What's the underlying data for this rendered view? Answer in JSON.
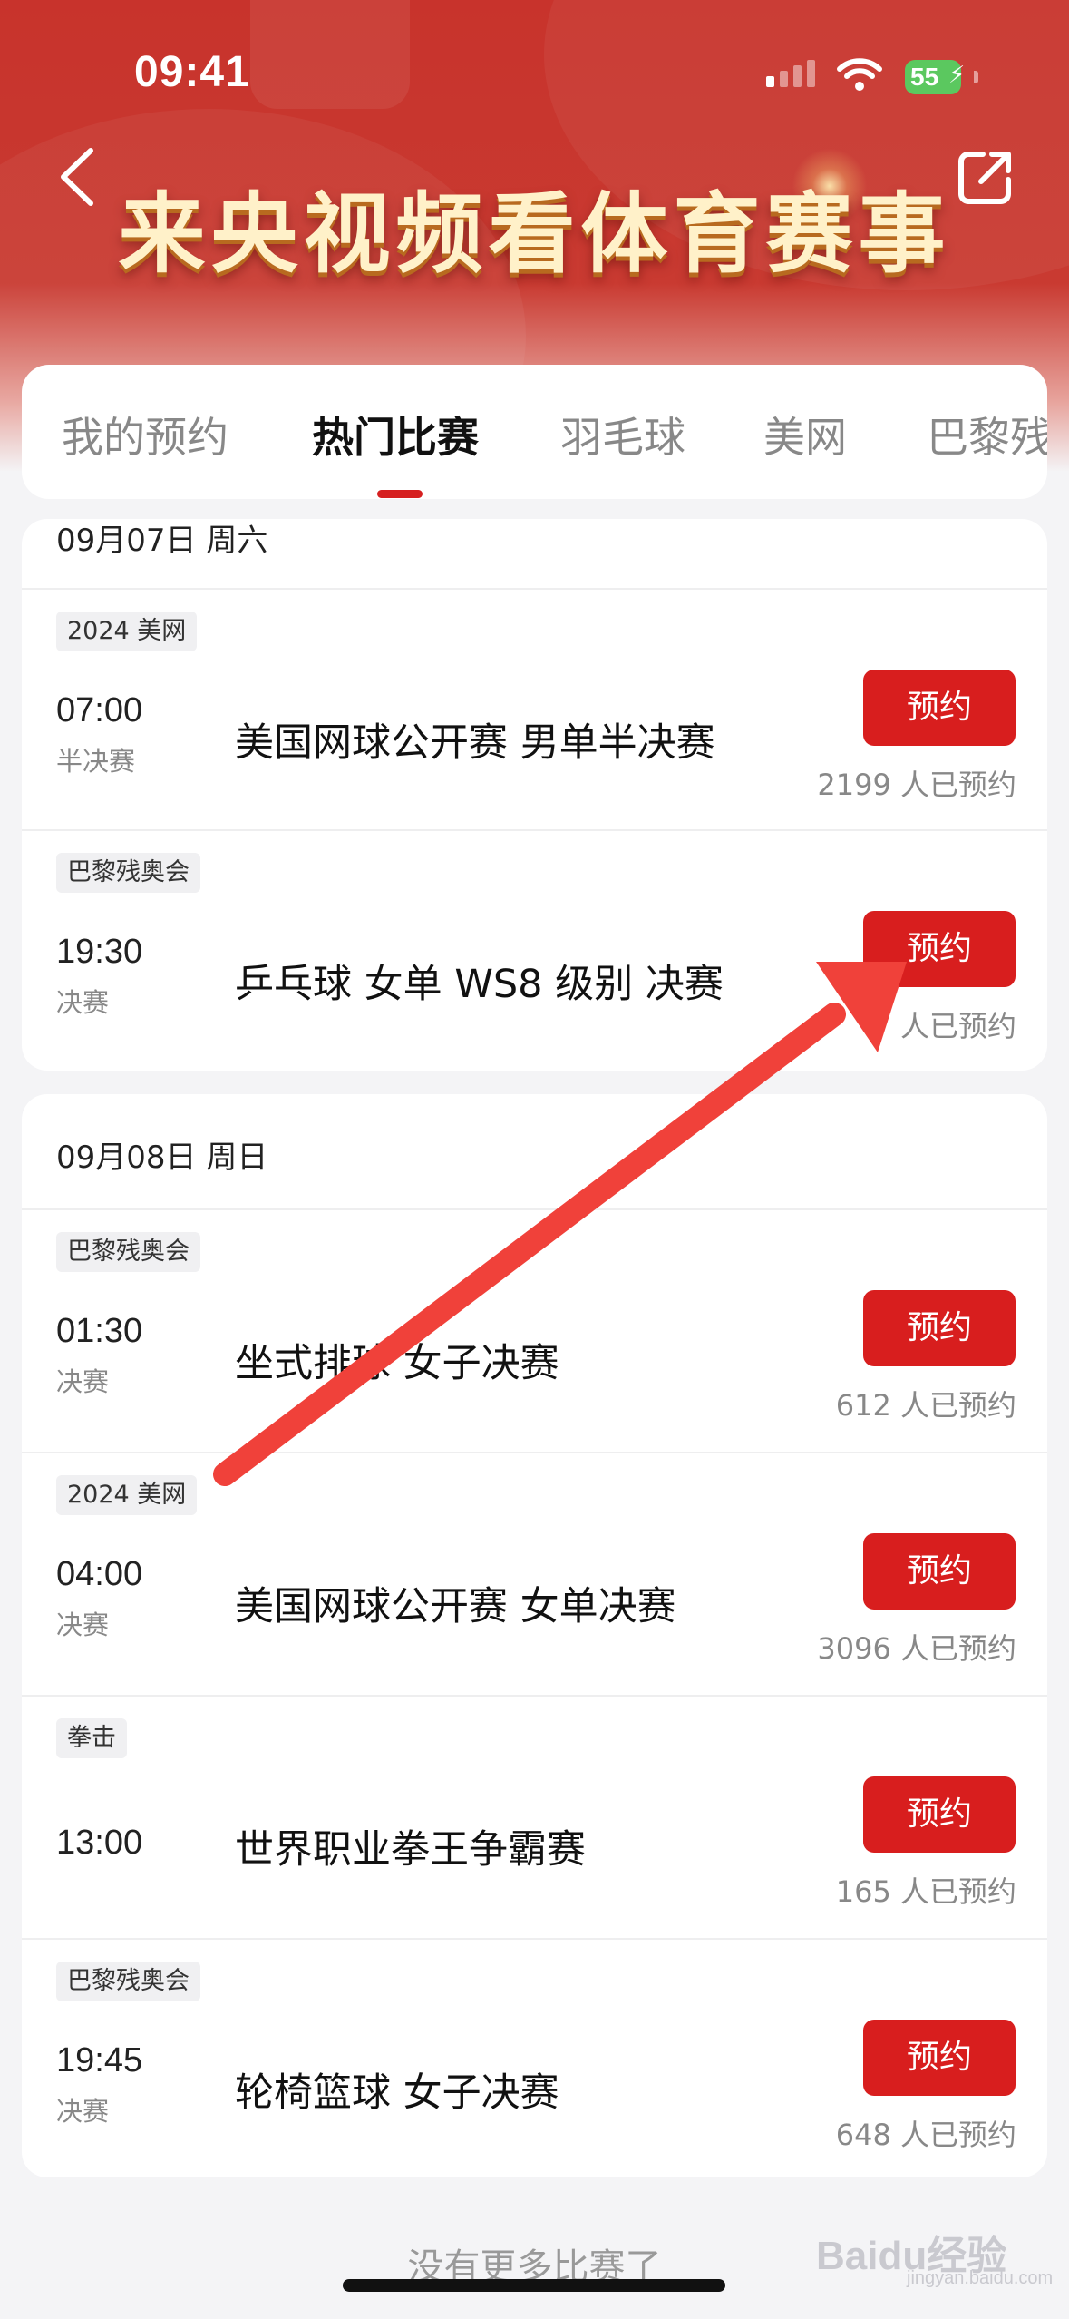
{
  "status_bar": {
    "time": "09:41",
    "battery": "55"
  },
  "header": {
    "title": "来央视频看体育赛事",
    "back_icon": "chevron-left-icon",
    "share_icon": "share-icon"
  },
  "tabs": [
    {
      "label": "我的预约"
    },
    {
      "label": "热门比赛"
    },
    {
      "label": "羽毛球"
    },
    {
      "label": "美网"
    },
    {
      "label": "巴黎残"
    }
  ],
  "active_tab": "热门比赛",
  "days": [
    {
      "date": "09月07日 周六",
      "events": [
        {
          "tag": "2024 美网",
          "time": "07:00",
          "stage": "半决赛",
          "title": "美国网球公开赛 男单半决赛",
          "button": "预约",
          "booked": "2199 人已预约"
        },
        {
          "tag": "巴黎残奥会",
          "time": "19:30",
          "stage": "决赛",
          "title": "乒乓球 女单 WS8 级别 决赛",
          "button": "预约",
          "booked": "7 人已预约"
        }
      ]
    },
    {
      "date": "09月08日 周日",
      "events": [
        {
          "tag": "巴黎残奥会",
          "time": "01:30",
          "stage": "决赛",
          "title": "坐式排球 女子决赛",
          "button": "预约",
          "booked": "612 人已预约"
        },
        {
          "tag": "2024 美网",
          "time": "04:00",
          "stage": "决赛",
          "title": "美国网球公开赛 女单决赛",
          "button": "预约",
          "booked": "3096 人已预约"
        },
        {
          "tag": "拳击",
          "time": "13:00",
          "stage": "",
          "title": "世界职业拳王争霸赛",
          "button": "预约",
          "booked": "165 人已预约"
        },
        {
          "tag": "巴黎残奥会",
          "time": "19:45",
          "stage": "决赛",
          "title": "轮椅篮球 女子决赛",
          "button": "预约",
          "booked": "648 人已预约"
        }
      ]
    }
  ],
  "footer": "没有更多比赛了",
  "watermark": {
    "brand": "Baidu经验",
    "sub": "jingyan.baidu.com"
  },
  "colors": {
    "primary_red": "#d81e1e",
    "header_red": "#c8332c",
    "annotation_arrow": "#f0413a"
  }
}
